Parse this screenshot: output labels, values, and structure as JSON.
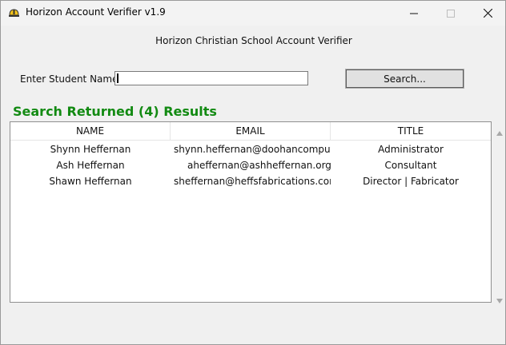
{
  "window": {
    "title": "Horizon Account Verifier v1.9",
    "buttons": {
      "minimize": "—",
      "maximize": "☐",
      "close": "✕"
    }
  },
  "main": {
    "heading": "Horizon Christian School Account Verifier",
    "search": {
      "label": "Enter Student Name:",
      "value": "",
      "button_label": "Search..."
    },
    "results_label": "Search Returned (4) Results",
    "table": {
      "columns": [
        "NAME",
        "EMAIL",
        "TITLE"
      ],
      "rows": [
        [
          "Shynn Heffernan",
          "shynn.heffernan@doohancomputers",
          "Administrator"
        ],
        [
          "Ash Heffernan",
          "aheffernan@ashheffernan.org",
          "Consultant"
        ],
        [
          "Shawn Heffernan",
          "sheffernan@heffsfabrications.com.a",
          "Director | Fabricator"
        ]
      ]
    }
  },
  "icons": {
    "app": "hardhat-icon",
    "scroll_up": "arrow-up-icon",
    "scroll_down": "arrow-down-icon"
  }
}
